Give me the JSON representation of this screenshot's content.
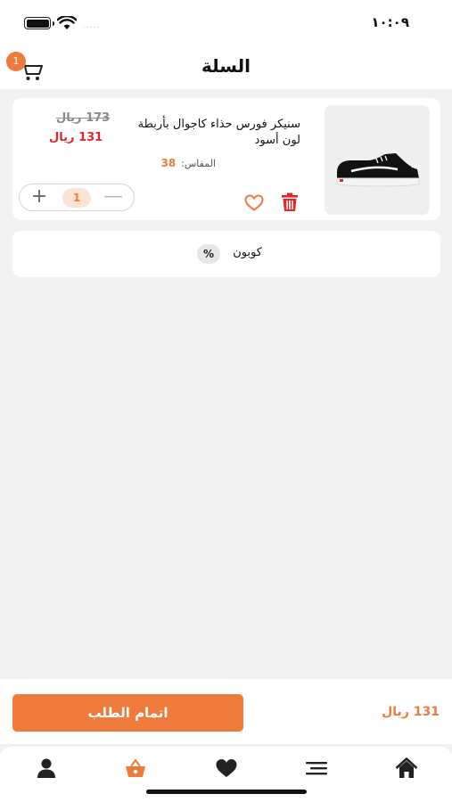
{
  "status_bar": {
    "time": "١٠:٠٩",
    "signal": "....."
  },
  "header": {
    "title": "السلة",
    "cart_badge": "1"
  },
  "cart_item": {
    "name": "سنيكر فورس حذاء كاجوال بأربطة لون أسود",
    "size_label": "المقاس:",
    "size_value": "38",
    "old_price": "173 ريال",
    "price": "131 ريال",
    "quantity": "1",
    "plus_symbol": "+",
    "minus_symbol": "—"
  },
  "coupon": {
    "label": "كوبون",
    "icon_symbol": "%"
  },
  "checkout": {
    "button_label": "اتمام الطلب",
    "total": "131 ريال"
  },
  "tabs": [
    {
      "icon": "profile-icon",
      "active": false
    },
    {
      "icon": "basket-icon",
      "active": true
    },
    {
      "icon": "heart-icon",
      "active": false
    },
    {
      "icon": "menu-icon",
      "active": false
    },
    {
      "icon": "home-icon",
      "active": false
    }
  ],
  "colors": {
    "accent": "#ee7a3b",
    "price_red": "#e0262b",
    "background": "#f2f2f2"
  }
}
